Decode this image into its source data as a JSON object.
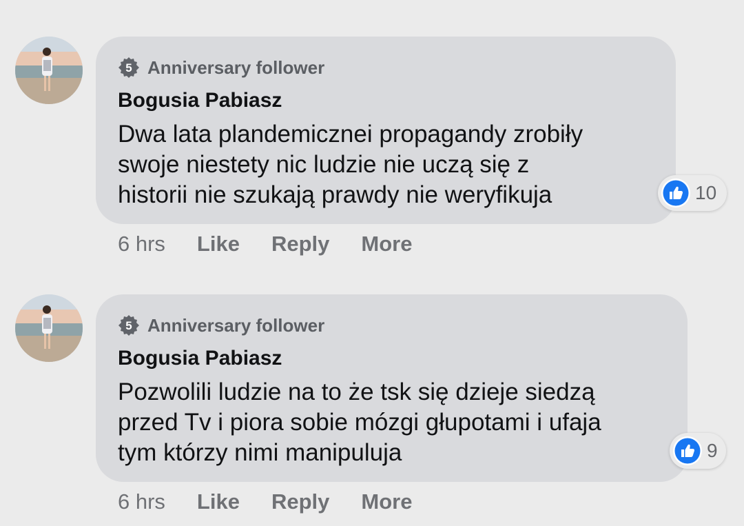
{
  "comments": [
    {
      "badge_number": "5",
      "badge_label": "Anniversary follower",
      "author": "Bogusia Pabiasz",
      "text": "Dwa lata plandemicznei propagandy zrobiły\nswoje niestety nic ludzie nie uczą się z\nhistorii nie szukają prawdy nie weryfikuja",
      "reaction_count": "10",
      "time": "6 hrs",
      "like_label": "Like",
      "reply_label": "Reply",
      "more_label": "More"
    },
    {
      "badge_number": "5",
      "badge_label": "Anniversary follower",
      "author": "Bogusia Pabiasz",
      "text": "Pozwolili ludzie na to że tsk się dzieje siedzą\nprzed Tv i piora sobie mózgi głupotami i ufaja\ntym którzy nimi manipuluja",
      "reaction_count": "9",
      "time": "6 hrs",
      "like_label": "Like",
      "reply_label": "Reply",
      "more_label": "More"
    }
  ],
  "colors": {
    "background": "#ebebeb",
    "bubble": "#d9dadd",
    "text": "#111214",
    "muted": "#6f7175",
    "like_blue": "#1877f2"
  },
  "icons": {
    "badge": "anniversary-badge-icon",
    "like": "thumbs-up-icon"
  }
}
